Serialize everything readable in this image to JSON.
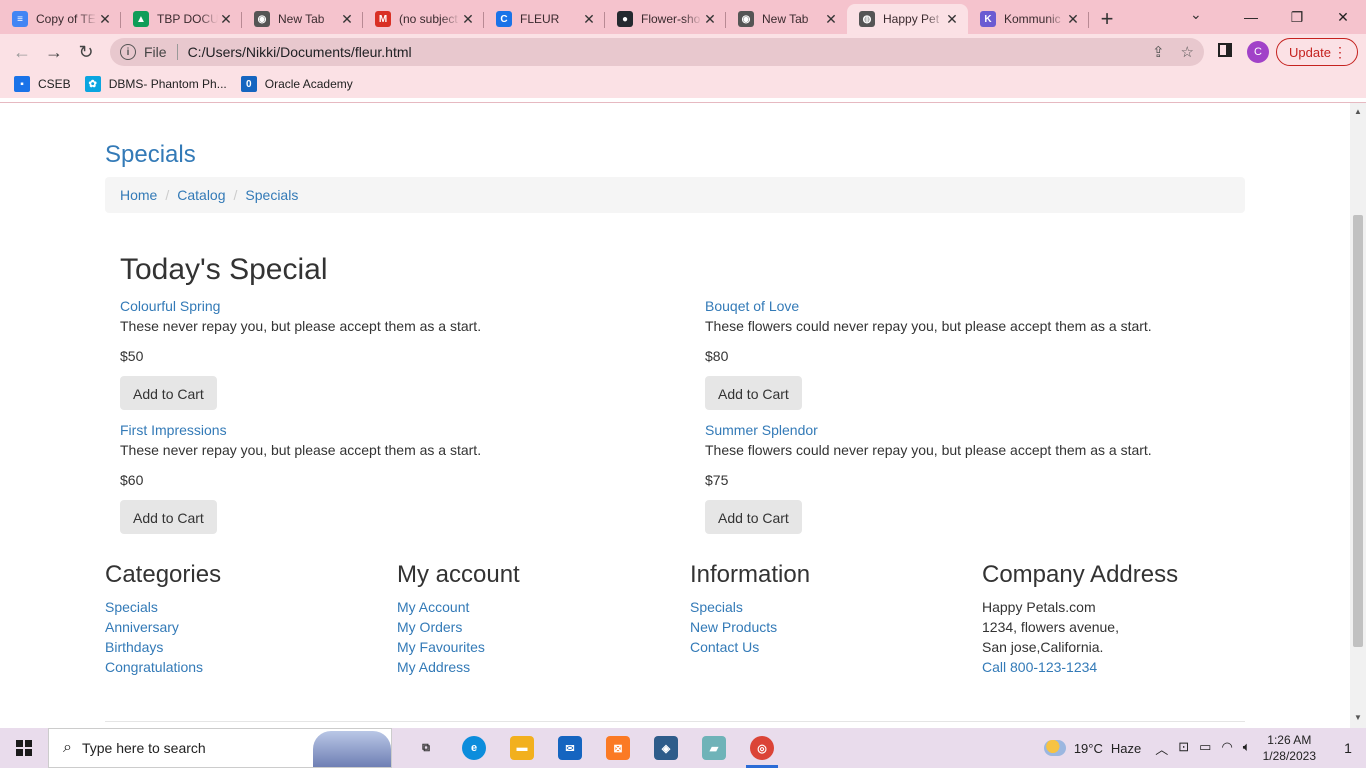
{
  "browser": {
    "tabs": [
      {
        "title": "Copy of TE",
        "favicon_color": "#4285f4",
        "favicon_glyph": "≡"
      },
      {
        "title": "TBP DOCU",
        "favicon_color": "#0f9d58",
        "favicon_glyph": "▲"
      },
      {
        "title": "New Tab",
        "favicon_color": "#555555",
        "favicon_glyph": "◉"
      },
      {
        "title": "(no subject",
        "favicon_color": "#d93025",
        "favicon_glyph": "M"
      },
      {
        "title": "FLEUR",
        "favicon_color": "#1a73e8",
        "favicon_glyph": "C"
      },
      {
        "title": "Flower-sho",
        "favicon_color": "#24292f",
        "favicon_glyph": "●"
      },
      {
        "title": "New Tab",
        "favicon_color": "#555555",
        "favicon_glyph": "◉"
      },
      {
        "title": "Happy Pet",
        "favicon_color": "#555555",
        "favicon_glyph": "◍"
      },
      {
        "title": "Kommunic",
        "favicon_color": "#6b5bd2",
        "favicon_glyph": "K"
      }
    ],
    "active_tab_index": 7,
    "address": {
      "scheme_label": "File",
      "url": "C:/Users/Nikki/Documents/fleur.html"
    },
    "profile_initial": "C",
    "update_label": "Update",
    "bookmarks": [
      {
        "label": "CSEB",
        "icon_color": "#1a73e8",
        "icon_glyph": "▪"
      },
      {
        "label": "DBMS- Phantom Ph...",
        "icon_color": "#0aa5e0",
        "icon_glyph": "✿"
      },
      {
        "label": "Oracle Academy",
        "icon_color": "#1565c0",
        "icon_glyph": "0"
      }
    ]
  },
  "page": {
    "title": "Specials",
    "breadcrumb": [
      "Home",
      "Catalog",
      "Specials"
    ],
    "section_heading": "Today's Special",
    "products": [
      {
        "name": "Colourful Spring",
        "description": "These never repay you, but please accept them as a start.",
        "price": "$50",
        "button": "Add to Cart"
      },
      {
        "name": "Bouqet of Love",
        "description": "These flowers could never repay you, but please accept them as a start.",
        "price": "$80",
        "button": "Add to Cart"
      },
      {
        "name": "First Impressions",
        "description": "These never repay you, but please accept them as a start.",
        "price": "$60",
        "button": "Add to Cart"
      },
      {
        "name": "Summer Splendor",
        "description": "These flowers could never repay you, but please accept them as a start.",
        "price": "$75",
        "button": "Add to Cart"
      }
    ],
    "footer": {
      "categories": {
        "heading": "Categories",
        "items": [
          "Specials",
          "Anniversary",
          "Birthdays",
          "Congratulations"
        ]
      },
      "account": {
        "heading": "My account",
        "items": [
          "My Account",
          "My Orders",
          "My Favourites",
          "My Address"
        ]
      },
      "information": {
        "heading": "Information",
        "items": [
          "Specials",
          "New Products",
          "Contact Us"
        ]
      },
      "address": {
        "heading": "Company Address",
        "lines": [
          "Happy Petals.com",
          "1234, flowers avenue,",
          "San jose,California."
        ],
        "phone": "Call 800-123-1234"
      }
    }
  },
  "taskbar": {
    "search_placeholder": "Type here to search",
    "weather": {
      "temp": "19°C",
      "condition": "Haze"
    },
    "time": "1:26 AM",
    "date": "1/28/2023",
    "notification_count": "1",
    "apps": [
      {
        "name": "task-view",
        "color": "#333333",
        "glyph": "⧉"
      },
      {
        "name": "edge",
        "color": "#0c8ddc",
        "glyph": "e"
      },
      {
        "name": "file-explorer",
        "color": "#f2b01e",
        "glyph": "▬"
      },
      {
        "name": "mail",
        "color": "#1565c0",
        "glyph": "✉"
      },
      {
        "name": "xampp",
        "color": "#fb7a24",
        "glyph": "⊠"
      },
      {
        "name": "mysql-workbench",
        "color": "#2e5c8a",
        "glyph": "◈"
      },
      {
        "name": "app-green",
        "color": "#6fb3b8",
        "glyph": "▰"
      },
      {
        "name": "chrome",
        "color": "#db4437",
        "glyph": "◎"
      }
    ]
  },
  "colors": {
    "link": "#337ab7",
    "chrome_bg": "#fbe1e5",
    "tabbar_bg": "#f5c3cd"
  }
}
